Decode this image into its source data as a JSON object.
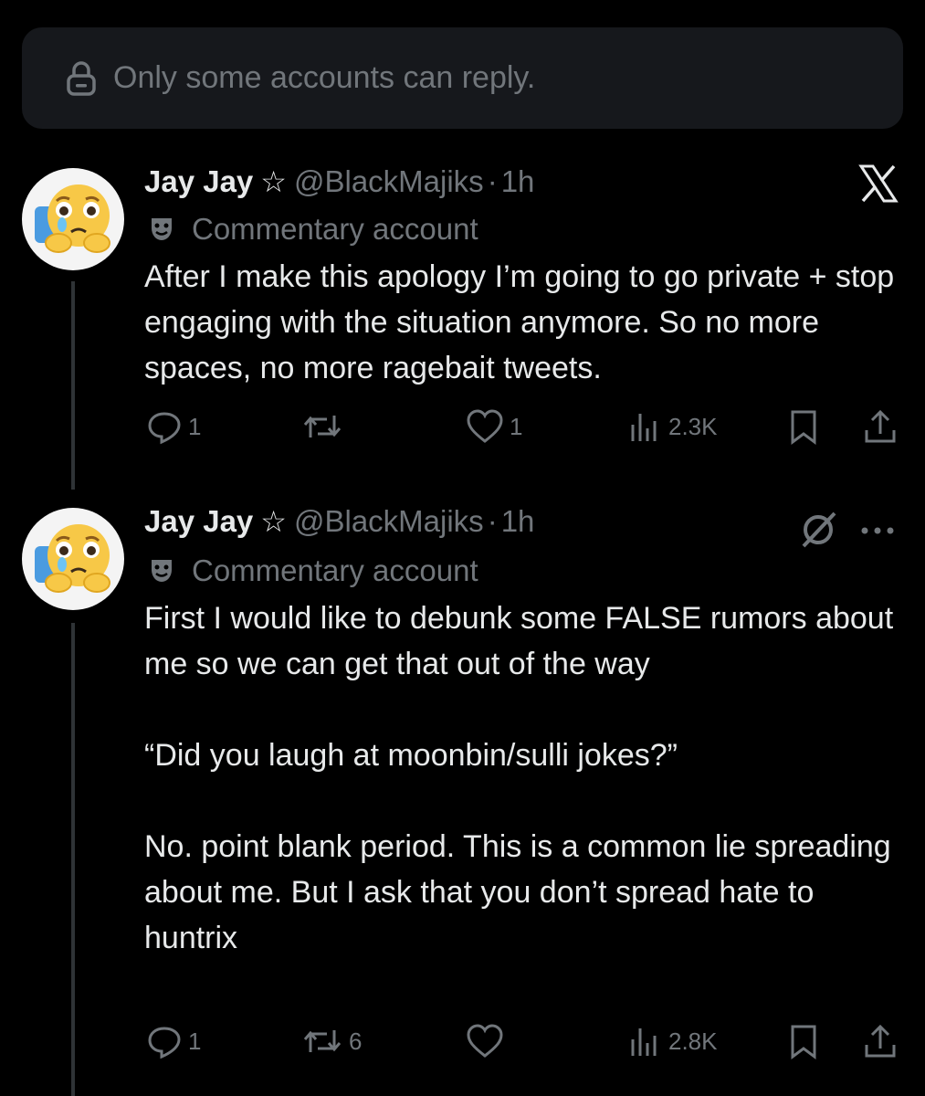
{
  "reply_restriction": {
    "text": "Only some accounts can reply."
  },
  "tweets": [
    {
      "name": "Jay Jay",
      "handle": "@BlackMajiks",
      "separator": "·",
      "time": "1h",
      "badge": "Commentary account",
      "text": "After I make this apology I’m going to go private + stop engaging with the situation anymore. So no more spaces, no more ragebait tweets.",
      "stats": {
        "replies": "1",
        "reposts": "",
        "likes": "1",
        "views": "2.3K"
      }
    },
    {
      "name": "Jay Jay",
      "handle": "@BlackMajiks",
      "separator": "·",
      "time": "1h",
      "badge": "Commentary account",
      "text": "First I would like to debunk some FALSE rumors about me so we can get that out of the way\n\n“Did you laugh at moonbin/sulli jokes?”\n\nNo. point blank period. This is a common lie spreading about me. But I ask that you don’t spread hate to huntrix",
      "stats": {
        "replies": "1",
        "reposts": "6",
        "likes": "",
        "views": "2.8K"
      }
    }
  ],
  "icons": {
    "lock": "lock-icon",
    "star": "star-outline-icon",
    "mask": "theater-mask-icon",
    "x_logo": "x-logo-icon",
    "grok": "grok-icon",
    "more": "more-dots-icon",
    "reply": "reply-icon",
    "repost": "repost-icon",
    "like": "heart-icon",
    "views": "views-chart-icon",
    "bookmark": "bookmark-icon",
    "share": "share-icon"
  },
  "colors": {
    "background": "#000000",
    "text": "#e7e9ea",
    "muted": "#71767b",
    "banner": "#16181c"
  }
}
